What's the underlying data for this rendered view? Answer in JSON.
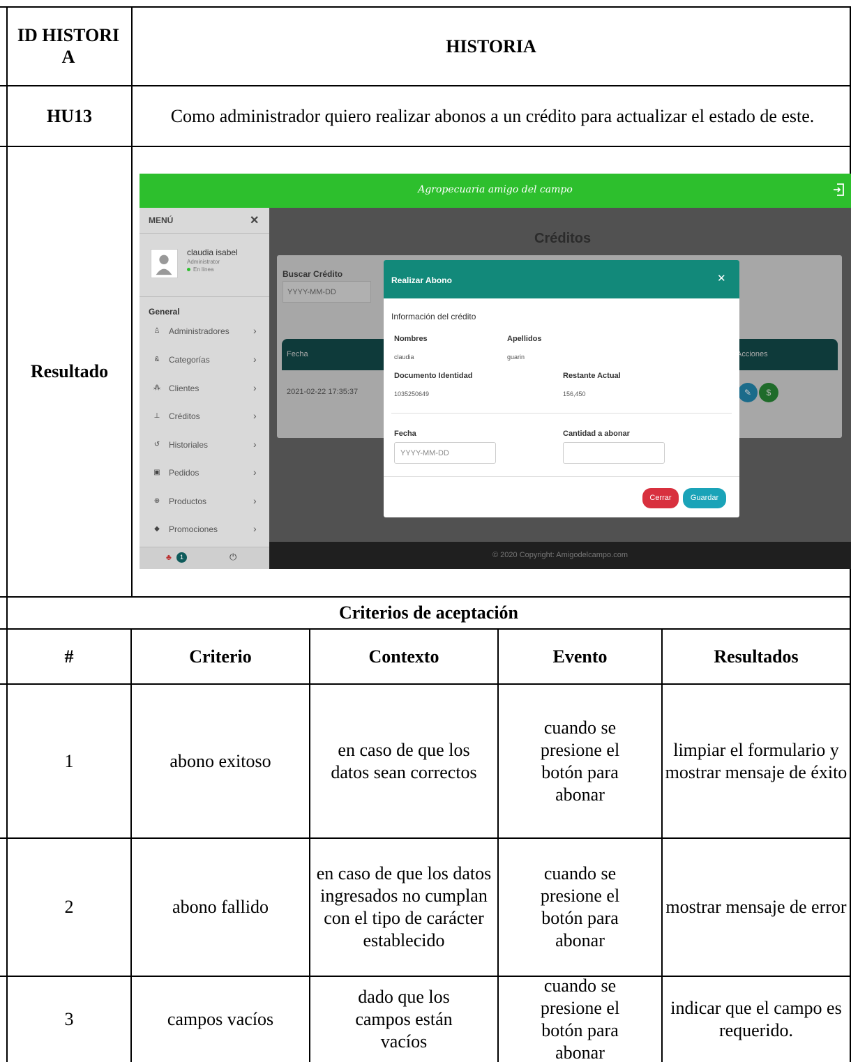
{
  "header": {
    "id_label": "ID HISTORI A",
    "story_label": "HISTORIA"
  },
  "story": {
    "id": "HU13",
    "text": "Como administrador quiero realizar abonos a un crédito para actualizar el estado de este."
  },
  "result_label": "Resultado",
  "screenshot": {
    "brand": "Agropecuaria amigo del campo",
    "menu_title": "MENÚ",
    "user": {
      "name": "claudia isabel",
      "role": "Administrator",
      "status": "En línea"
    },
    "section": "General",
    "menu_items": [
      {
        "icon": "users-icon",
        "label": "Administradores"
      },
      {
        "icon": "tag-icon",
        "label": "Categorías"
      },
      {
        "icon": "group-icon",
        "label": "Clientes"
      },
      {
        "icon": "hand-coin-icon",
        "label": "Créditos"
      },
      {
        "icon": "history-icon",
        "label": "Historiales"
      },
      {
        "icon": "box-icon",
        "label": "Pedidos"
      },
      {
        "icon": "globe-icon",
        "label": "Productos"
      },
      {
        "icon": "tags-icon",
        "label": "Promociones"
      }
    ],
    "notification_count": "1",
    "page_title": "Créditos",
    "search_label": "Buscar Crédito",
    "search_placeholder": "YYYY-MM-DD",
    "table_headers": {
      "fecha": "Fecha",
      "acciones": "Acciones"
    },
    "table_row": {
      "fecha": "2021-02-22 17:35:37"
    },
    "copyright": "© 2020 Copyright: Amigodelcampo.com",
    "modal": {
      "title": "Realizar Abono",
      "info_title": "Información del crédito",
      "nombres_label": "Nombres",
      "nombres_value": "claudia",
      "apellidos_label": "Apellidos",
      "apellidos_value": "guarin",
      "documento_label": "Documento Identidad",
      "documento_value": "1035250649",
      "restante_label": "Restante Actual",
      "restante_value": "156,450",
      "fecha_label": "Fecha",
      "fecha_placeholder": "YYYY-MM-DD",
      "cantidad_label": "Cantidad a abonar",
      "cerrar": "Cerrar",
      "guardar": "Guardar"
    }
  },
  "criteria": {
    "title": "Criterios de aceptación",
    "headers": [
      "#",
      "Criterio",
      "Contexto",
      "Evento",
      "Resultados"
    ],
    "rows": [
      [
        "1",
        "abono exitoso",
        "en caso de que los datos sean correctos",
        "cuando se presione el botón para abonar",
        "limpiar el formulario y mostrar mensaje de éxito"
      ],
      [
        "2",
        "abono fallido",
        "en caso de que los datos ingresados no cumplan con el tipo de carácter establecido",
        "cuando se presione el botón para abonar",
        "mostrar mensaje de error"
      ],
      [
        "3",
        "campos vacíos",
        "dado que los campos están vacíos",
        "cuando se presione el botón para abonar",
        "indicar que el campo es requerido."
      ]
    ]
  }
}
